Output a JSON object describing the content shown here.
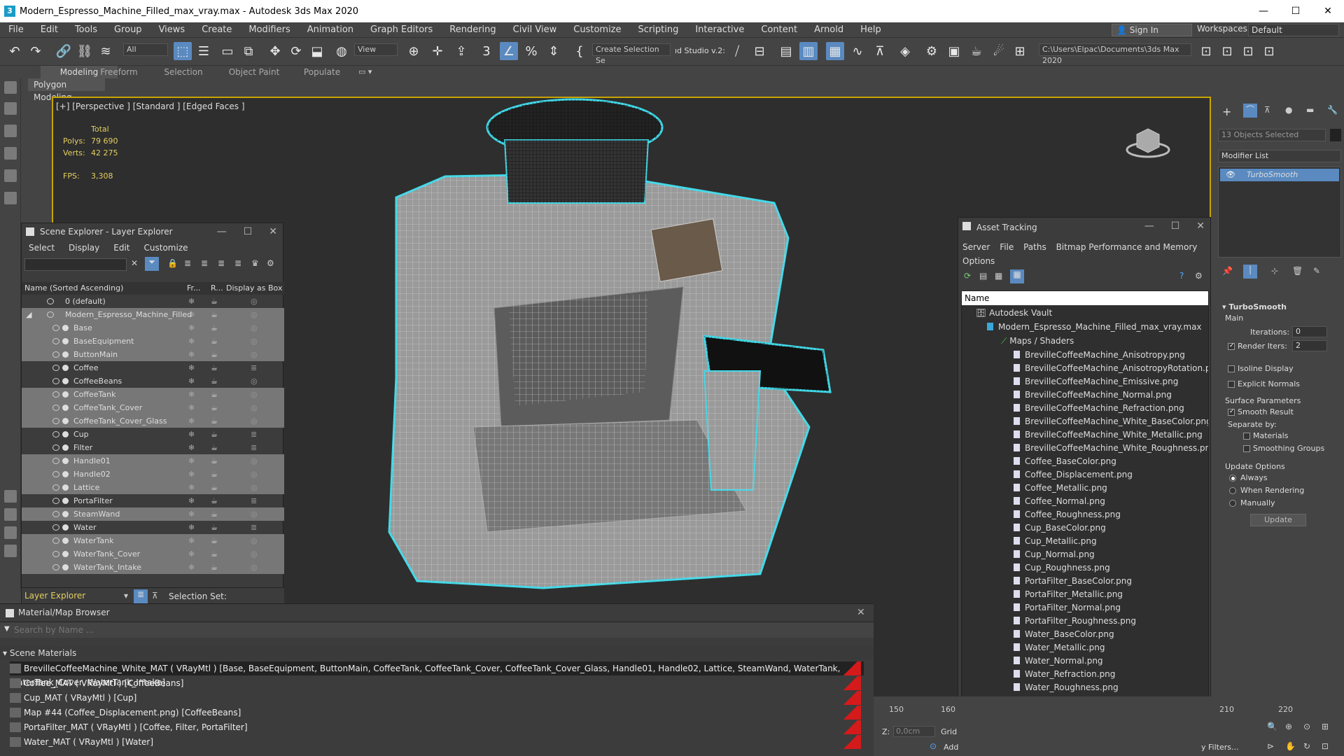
{
  "app": {
    "title": "Modern_Espresso_Machine_Filled_max_vray.max - Autodesk 3ds Max 2020",
    "icon_letter": "3"
  },
  "window_controls": {
    "minimize": "—",
    "maximize": "☐",
    "close": "✕"
  },
  "menu": [
    "File",
    "Edit",
    "Tools",
    "Group",
    "Views",
    "Create",
    "Modifiers",
    "Animation",
    "Graph Editors",
    "Rendering",
    "Civil View",
    "Customize",
    "Scripting",
    "Interactive",
    "Content",
    "Arnold",
    "Help"
  ],
  "signin": "Sign In",
  "workspaces_label": "Workspaces:",
  "workspace_value": "Default",
  "toolbar": {
    "filter_value": "All",
    "refcoord": "View",
    "selection_set": "Create Selection Se",
    "studio": "ıd Studio v.2:",
    "path": "C:\\Users\\Elpac\\Documents\\3ds Max 2020"
  },
  "ribbon": {
    "tabs": [
      "Modeling",
      "Freeform",
      "Selection",
      "Object Paint",
      "Populate"
    ],
    "subtab": "Polygon Modeling"
  },
  "viewport": {
    "label": "[+] [Perspective ] [Standard ] [Edged Faces ]",
    "stats": {
      "total_label": "Total",
      "polys_label": "Polys:",
      "polys": "79 690",
      "verts_label": "Verts:",
      "verts": "42 275",
      "fps_label": "FPS:",
      "fps": "3,308"
    }
  },
  "scene_explorer": {
    "title": "Scene Explorer - Layer Explorer",
    "menu": [
      "Select",
      "Display",
      "Edit",
      "Customize"
    ],
    "columns": [
      "Name (Sorted Ascending)",
      "Fr...",
      "R...",
      "Display as Box"
    ],
    "layer_default": "0 (default)",
    "layer_main": "Modern_Espresso_Machine_Filled",
    "objects": [
      "Base",
      "BaseEquipment",
      "ButtonMain",
      "Coffee",
      "CoffeeBeans",
      "CoffeeTank",
      "CoffeeTank_Cover",
      "CoffeeTank_Cover_Glass",
      "Cup",
      "Filter",
      "Handle01",
      "Handle02",
      "Lattice",
      "PortaFilter",
      "SteamWand",
      "Water",
      "WaterTank",
      "WaterTank_Cover",
      "WaterTank_Intake"
    ],
    "footer_mode": "Layer Explorer",
    "footer_sel": "Selection Set:"
  },
  "asset_tracking": {
    "title": "Asset Tracking",
    "menu": [
      "Server",
      "File",
      "Paths",
      "Bitmap Performance and Memory",
      "Options"
    ],
    "col_name": "Name",
    "vault": "Autodesk Vault",
    "file": "Modern_Espresso_Machine_Filled_max_vray.max",
    "maps": "Maps / Shaders",
    "textures": [
      "BrevilleCoffeeMachine_Anisotropy.png",
      "BrevilleCoffeeMachine_AnisotropyRotation.png",
      "BrevilleCoffeeMachine_Emissive.png",
      "BrevilleCoffeeMachine_Normal.png",
      "BrevilleCoffeeMachine_Refraction.png",
      "BrevilleCoffeeMachine_White_BaseColor.png",
      "BrevilleCoffeeMachine_White_Metallic.png",
      "BrevilleCoffeeMachine_White_Roughness.png",
      "Coffee_BaseColor.png",
      "Coffee_Displacement.png",
      "Coffee_Metallic.png",
      "Coffee_Normal.png",
      "Coffee_Roughness.png",
      "Cup_BaseColor.png",
      "Cup_Metallic.png",
      "Cup_Normal.png",
      "Cup_Roughness.png",
      "PortaFilter_BaseColor.png",
      "PortaFilter_Metallic.png",
      "PortaFilter_Normal.png",
      "PortaFilter_Roughness.png",
      "Water_BaseColor.png",
      "Water_Metallic.png",
      "Water_Normal.png",
      "Water_Refraction.png",
      "Water_Roughness.png"
    ]
  },
  "material_browser": {
    "title": "Material/Map Browser",
    "search_placeholder": "Search by Name ...",
    "group": "Scene Materials",
    "materials": [
      "BrevilleCoffeeMachine_White_MAT ( VRayMtl ) [Base, BaseEquipment, ButtonMain, CoffeeTank, CoffeeTank_Cover, CoffeeTank_Cover_Glass, Handle01, Handle02, Lattice, SteamWand, WaterTank, WaterTank_Cover, WaterTank_Intake]",
      "Coffee_MAT ( VRayMtl ) [CoffeeBeans]",
      "Cup_MAT ( VRayMtl ) [Cup]",
      "Map #44 (Coffee_Displacement.png) [CoffeeBeans]",
      "PortaFilter_MAT ( VRayMtl ) [Coffee, Filter, PortaFilter]",
      "Water_MAT ( VRayMtl ) [Water]"
    ]
  },
  "command_panel": {
    "objects_selected": "13 Objects Selected",
    "modifier_list": "Modifier List",
    "modifier": "TurboSmooth",
    "rollout": "TurboSmooth",
    "main": "Main",
    "iterations_label": "Iterations:",
    "iterations": "0",
    "render_iters_label": "Render Iters:",
    "render_iters": "2",
    "isoline": "Isoline Display",
    "explicit": "Explicit Normals",
    "surface": "Surface Parameters",
    "smooth": "Smooth Result",
    "separate": "Separate by:",
    "materials": "Materials",
    "smoothing": "Smoothing Groups",
    "update_opts": "Update Options",
    "always": "Always",
    "when_rendering": "When Rendering",
    "manually": "Manually",
    "update_btn": "Update"
  },
  "timeline": {
    "ticks": [
      "150",
      "160",
      "210",
      "220"
    ]
  },
  "status": {
    "z_label": "Z:",
    "z_value": "0,0cm",
    "grid": "Grid",
    "add": "Add",
    "filters": "y Filters..."
  }
}
